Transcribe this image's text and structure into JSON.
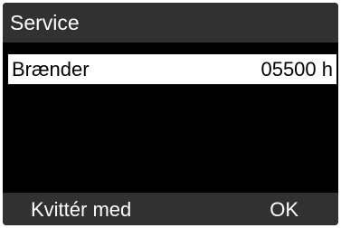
{
  "header": {
    "title": "Service"
  },
  "list": {
    "items": [
      {
        "label": "Brænder",
        "value": "05500 h"
      }
    ]
  },
  "footer": {
    "left_softkey": "Kvittér med",
    "right_softkey": "OK"
  },
  "colors": {
    "screen_background": "#000000",
    "bar_background": "#313131",
    "highlight_background": "#ffffff",
    "text_light": "#ffffff",
    "text_dark": "#000000"
  }
}
